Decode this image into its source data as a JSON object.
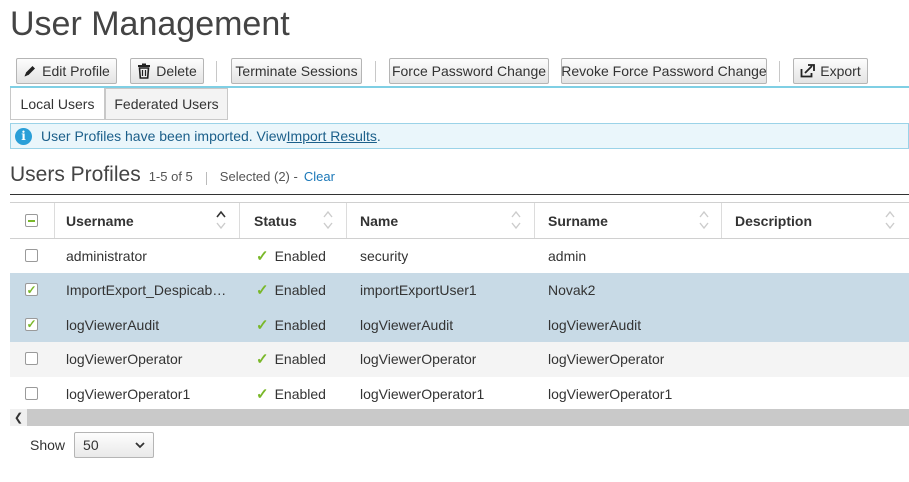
{
  "page": {
    "title": "User Management"
  },
  "toolbar": {
    "edit_profile": "Edit Profile",
    "delete": "Delete",
    "terminate_sessions": "Terminate Sessions",
    "force_password_change": "Force Password Change",
    "revoke_force_password_change": "Revoke Force Password Change",
    "export": "Export"
  },
  "tabs": [
    {
      "label": "Local Users",
      "active": true
    },
    {
      "label": "Federated Users",
      "active": false
    }
  ],
  "notice": {
    "text": "User Profiles have been imported. View ",
    "link": "Import Results",
    "suffix": "."
  },
  "section": {
    "title": "Users Profiles",
    "count": "1-5 of 5",
    "selected": "Selected (2) -",
    "clear": "Clear"
  },
  "table": {
    "columns": [
      "Username",
      "Status",
      "Name",
      "Surname",
      "Description"
    ],
    "rows": [
      {
        "checked": false,
        "username": "administrator",
        "status": "Enabled",
        "name": "security",
        "surname": "admin",
        "description": ""
      },
      {
        "checked": true,
        "username": "ImportExport_DespicableMe",
        "status": "Enabled",
        "name": "importExportUser1",
        "surname": "Novak2",
        "description": ""
      },
      {
        "checked": true,
        "username": "logViewerAudit",
        "status": "Enabled",
        "name": "logViewerAudit",
        "surname": "logViewerAudit",
        "description": ""
      },
      {
        "checked": false,
        "username": "logViewerOperator",
        "status": "Enabled",
        "name": "logViewerOperator",
        "surname": "logViewerOperator",
        "description": ""
      },
      {
        "checked": false,
        "username": "logViewerOperator1",
        "status": "Enabled",
        "name": "logViewerOperator1",
        "surname": "logViewerOperator1",
        "description": ""
      }
    ]
  },
  "footer": {
    "show_label": "Show",
    "page_size": "50"
  },
  "colors": {
    "accent": "#7fcfe4",
    "selected_row": "#c8dae6",
    "enabled_check": "#7ab82a",
    "link": "#1b78b8"
  }
}
